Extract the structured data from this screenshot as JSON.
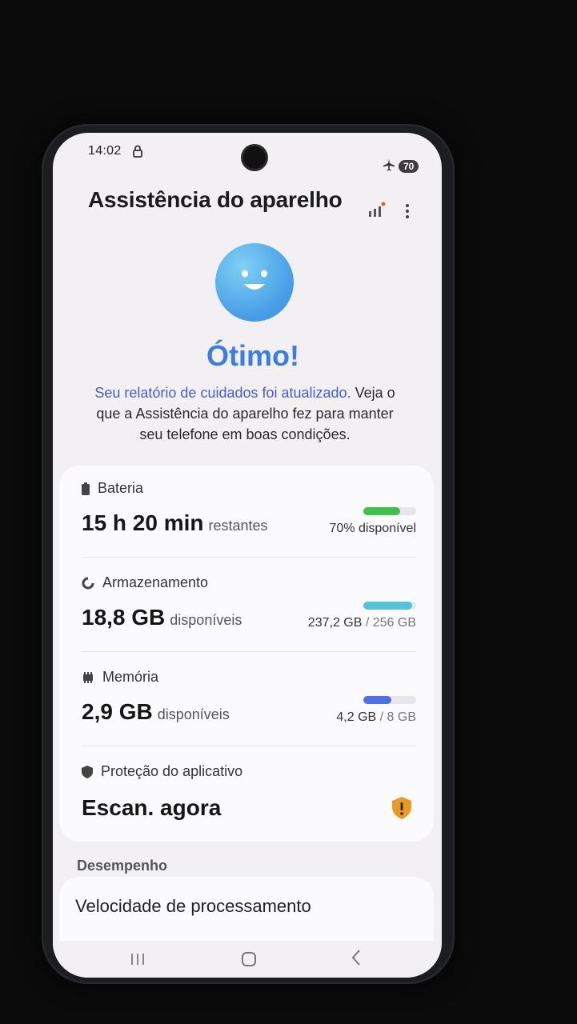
{
  "status_bar": {
    "time": "14:02",
    "battery": "70"
  },
  "header": {
    "title": "Assistência do aparelho"
  },
  "status": {
    "word": "Ótimo!"
  },
  "description": {
    "link_text": "Seu relatório de cuidados foi atualizado.",
    "text": " Veja o que a Assistência do aparelho fez para manter seu telefone em boas condições."
  },
  "items": [
    {
      "label": "Bateria",
      "value": "15 h 20 min",
      "sub": "restantes",
      "right": "70% disponível",
      "fraction": 0.7,
      "bar_color": "#3ec04a"
    },
    {
      "label": "Armazenamento",
      "value": "18,8 GB",
      "sub": "disponíveis",
      "right_main": "237,2 GB",
      "right_muted": " / 256 GB",
      "fraction": 0.93,
      "bar_color": "#55c3d6"
    },
    {
      "label": "Memória",
      "value": "2,9 GB",
      "sub": "disponíveis",
      "right_main": "4,2 GB",
      "right_muted": " / 8 GB",
      "fraction": 0.53,
      "bar_color": "#4e70e0"
    },
    {
      "label": "Proteção do aplicativo",
      "value": "Escan. agora"
    }
  ],
  "section": {
    "label": "Desempenho"
  },
  "performance": {
    "label": "Velocidade de processamento"
  },
  "colors": {
    "accent": "#3b7de0",
    "link": "#4a5dc2",
    "shield": "#e69a2b"
  }
}
